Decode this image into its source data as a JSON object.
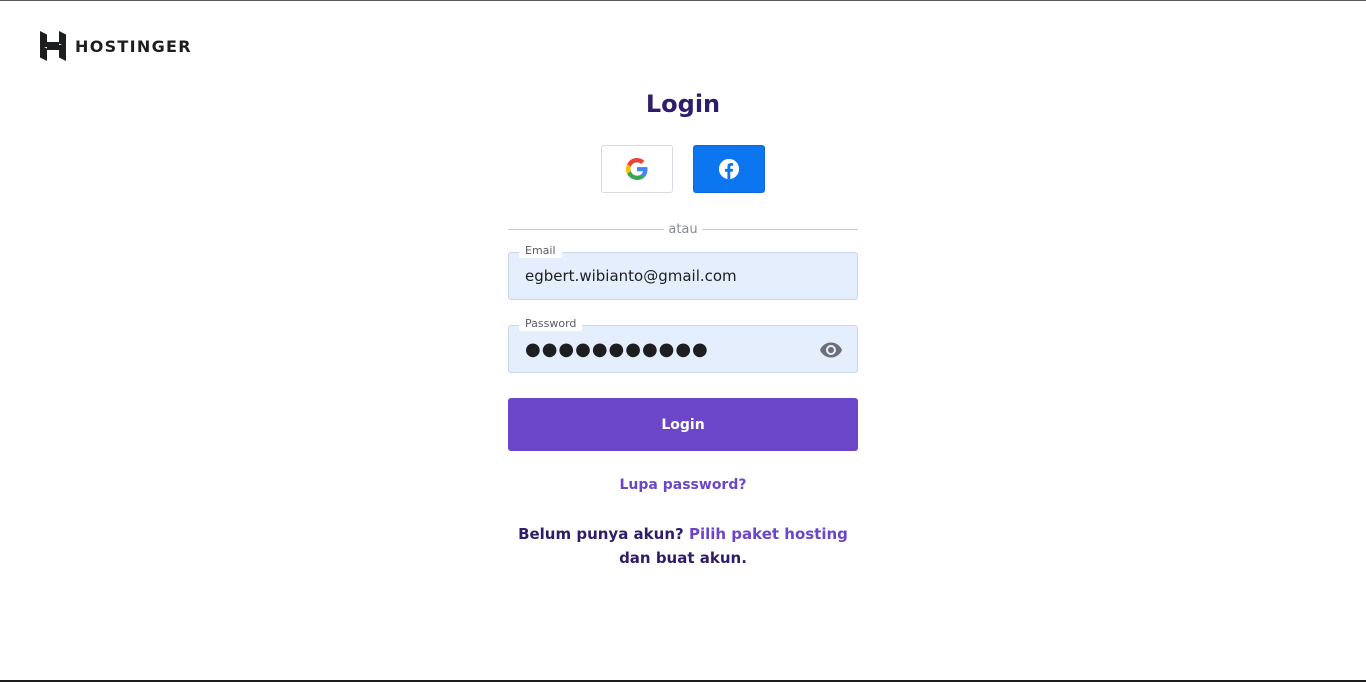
{
  "brand": {
    "name": "HOSTINGER"
  },
  "login": {
    "title": "Login",
    "divider_text": "atau",
    "social": {
      "google_icon": "google-g-icon",
      "facebook_icon": "facebook-f-icon",
      "facebook_color": "#0b76ef"
    },
    "email": {
      "label": "Email",
      "value": "egbert.wibianto@gmail.com"
    },
    "password": {
      "label": "Password",
      "value": "●●●●●●●●●●●",
      "toggle_icon": "eye-icon"
    },
    "submit_label": "Login",
    "forgot_label": "Lupa password?",
    "signup": {
      "prefix": "Belum punya akun?",
      "link": "Pilih paket hosting",
      "suffix": "dan buat akun."
    }
  },
  "colors": {
    "primary": "#6c46c8",
    "heading": "#2f1c6a",
    "field_bg": "#e4eefc"
  }
}
